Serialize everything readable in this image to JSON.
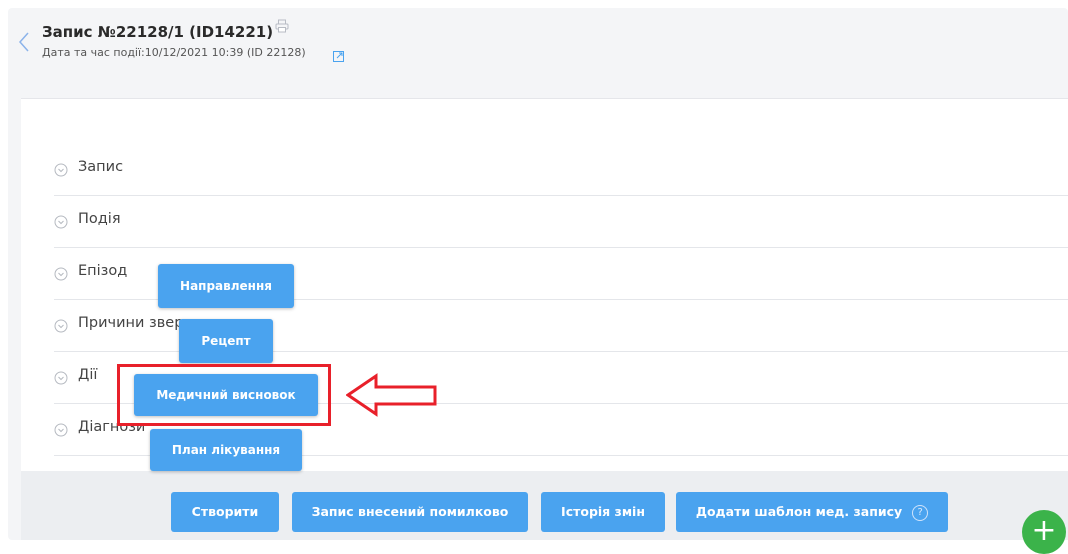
{
  "header": {
    "title_prefix": "Запис ",
    "title_number": "№22128/1",
    "title_id": " (ID14221)",
    "subtitle": "Дата та час події:10/12/2021 10:39 (ID 22128)"
  },
  "sections": [
    {
      "label": "Запис"
    },
    {
      "label": "Подія"
    },
    {
      "label": "Епізод"
    },
    {
      "label": "Причини звернення"
    },
    {
      "label": "Дії"
    },
    {
      "label": "Діагнози"
    }
  ],
  "popup_menu": {
    "referral": "Направлення",
    "prescription": "Рецепт",
    "medical_conclusion": "Медичний висновок",
    "treatment_plan": "План лікування"
  },
  "footer": {
    "create": "Створити",
    "entered_in_error": "Запис внесений помилково",
    "history": "Історія змін",
    "add_template": "Додати шаблон мед. запису",
    "help_glyph": "?"
  },
  "fab": {
    "glyph": "+"
  },
  "colors": {
    "accent": "#4aa3ef",
    "highlight": "#e8202a",
    "fab": "#3bb34a",
    "back": "#8bb3ea"
  },
  "icons": [
    "back-chevron-icon",
    "print-icon",
    "external-link-icon",
    "expand-chevron-icon",
    "help-icon",
    "plus-icon",
    "arrow-annotation"
  ]
}
